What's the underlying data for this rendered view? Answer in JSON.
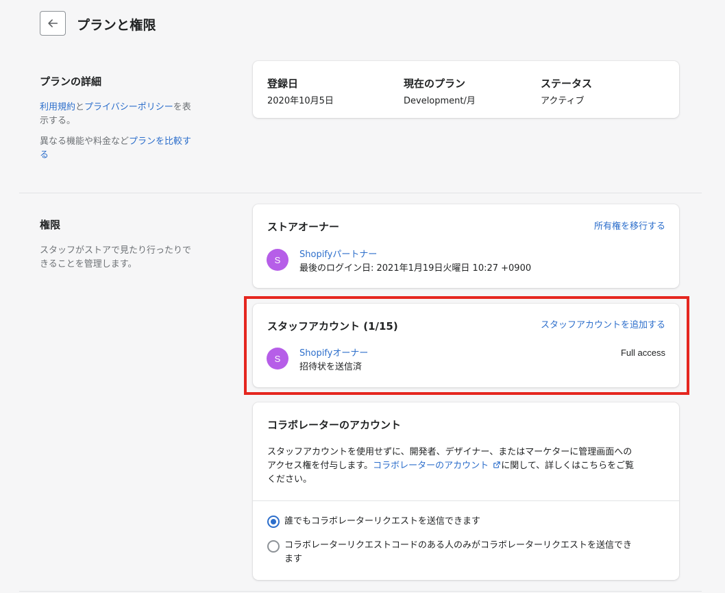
{
  "header": {
    "title": "プランと権限"
  },
  "plan_section": {
    "title": "プランの詳細",
    "terms_link": "利用規約",
    "and_text": "と",
    "privacy_link": "プライバシーポリシー",
    "view_text_1": "を表",
    "view_text_2": "示する。",
    "compare_prefix": "異なる機能や料金など",
    "compare_link_1": "プランを比較す",
    "compare_link_2": "る",
    "card": {
      "registered_label": "登録日",
      "registered_value": "2020年10月5日",
      "current_plan_label": "現在のプラン",
      "current_plan_value": "Development/月",
      "status_label": "ステータス",
      "status_value": "アクティブ"
    }
  },
  "permissions_section": {
    "title": "権限",
    "desc_1": "スタッフがストアで見たり行ったりで",
    "desc_2": "きることを管理します。",
    "owner_card": {
      "title": "ストアオーナー",
      "transfer_link": "所有権を移行する",
      "avatar_letter": "S",
      "name": "Shopifyパートナー",
      "last_login": "最後のログイン日: 2021年1月19日火曜日 10:27 +0900"
    },
    "staff_card": {
      "title": "スタッフアカウント (1/15)",
      "add_link": "スタッフアカウントを追加する",
      "avatar_letter": "S",
      "name": "Shopifyオーナー",
      "status": "招待状を送信済",
      "access": "Full access"
    },
    "collab_card": {
      "title": "コラボレーターのアカウント",
      "desc_1": "スタッフアカウントを使用せずに、開発者、デザイナー、またはマーケターに管理画面への",
      "desc_2_prefix": "アクセス権を付与します。",
      "desc_link": "コラボレーターのアカウント",
      "desc_2_suffix": "に関して、詳しくはこちらをご覧",
      "desc_3": "ください。",
      "option_1": "誰でもコラボレーターリクエストを送信できます",
      "option_2_line1": "コラボレーターリクエストコードのある人のみがコラボレーターリクエストを送信でき",
      "option_2_line2": "ます",
      "selected_option": 1
    }
  },
  "colors": {
    "link": "#2c6ecb",
    "avatar": "#b65ee8",
    "highlight": "#e5261f"
  },
  "icons": [
    "arrow-left-icon",
    "external-link-icon"
  ]
}
